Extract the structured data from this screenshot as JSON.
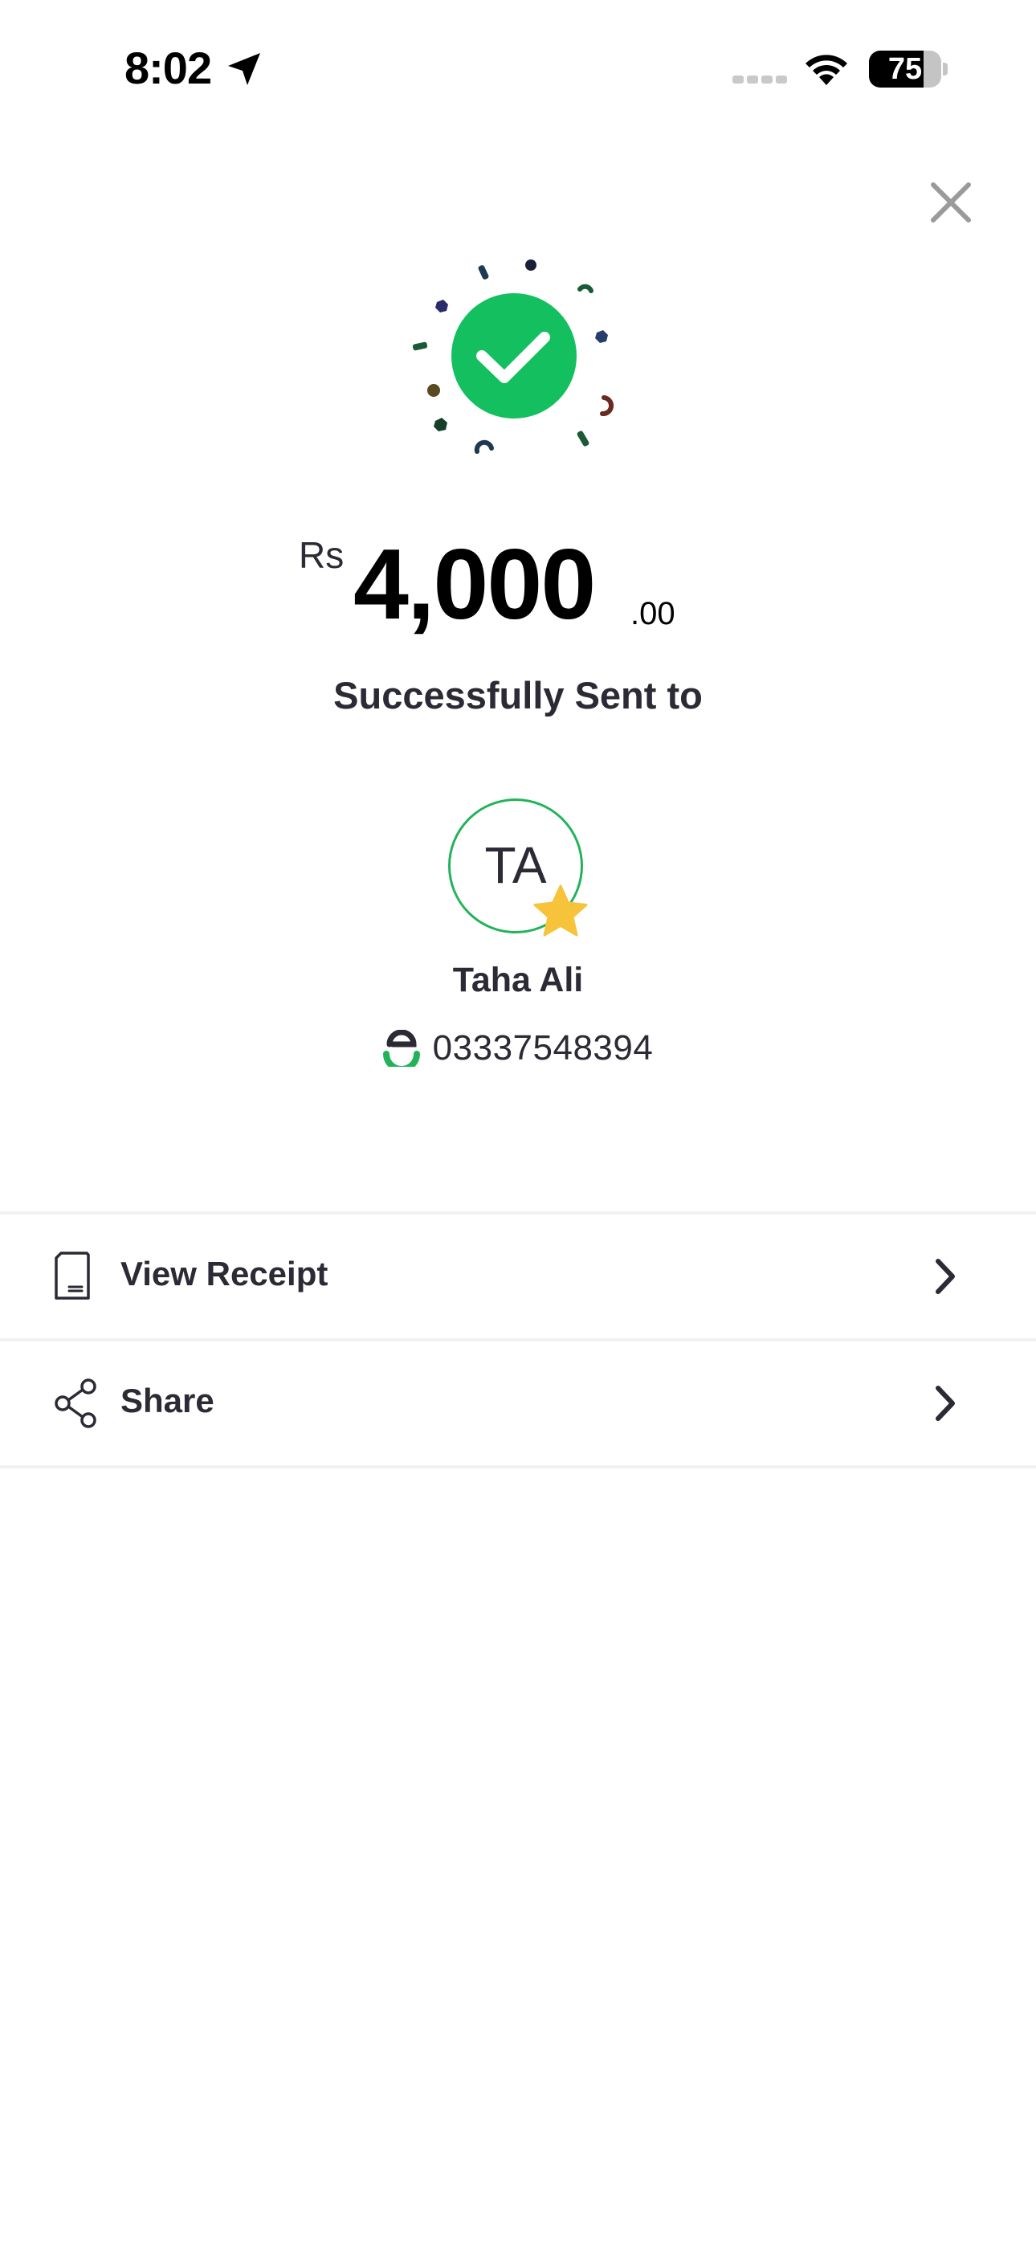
{
  "status_bar": {
    "time": "8:02",
    "battery_level": "75",
    "battery_percent": 75,
    "icons": [
      "location-arrow-icon",
      "cellular-signal-icon",
      "wifi-icon",
      "battery-icon"
    ]
  },
  "header": {
    "close_icon": "close-icon"
  },
  "result": {
    "success_icon": "check-circle-icon",
    "accent_color": "#13bf5f"
  },
  "amount": {
    "currency": "Rs",
    "value": "4,000",
    "decimals": ".00"
  },
  "status_text": "Successfully Sent to",
  "recipient": {
    "initials": "TA",
    "name": "Taha Ali",
    "account_number": "03337548394",
    "favorite_icon": "star-icon",
    "wallet_icon": "easypaisa-logo-icon"
  },
  "actions": [
    {
      "label": "View Receipt",
      "icon": "receipt-icon"
    },
    {
      "label": "Share",
      "icon": "share-icon"
    }
  ],
  "colors": {
    "success_green": "#13bf5f",
    "avatar_border": "#22b35a",
    "star": "#f7c33b",
    "text_dark": "#2b2a35"
  }
}
